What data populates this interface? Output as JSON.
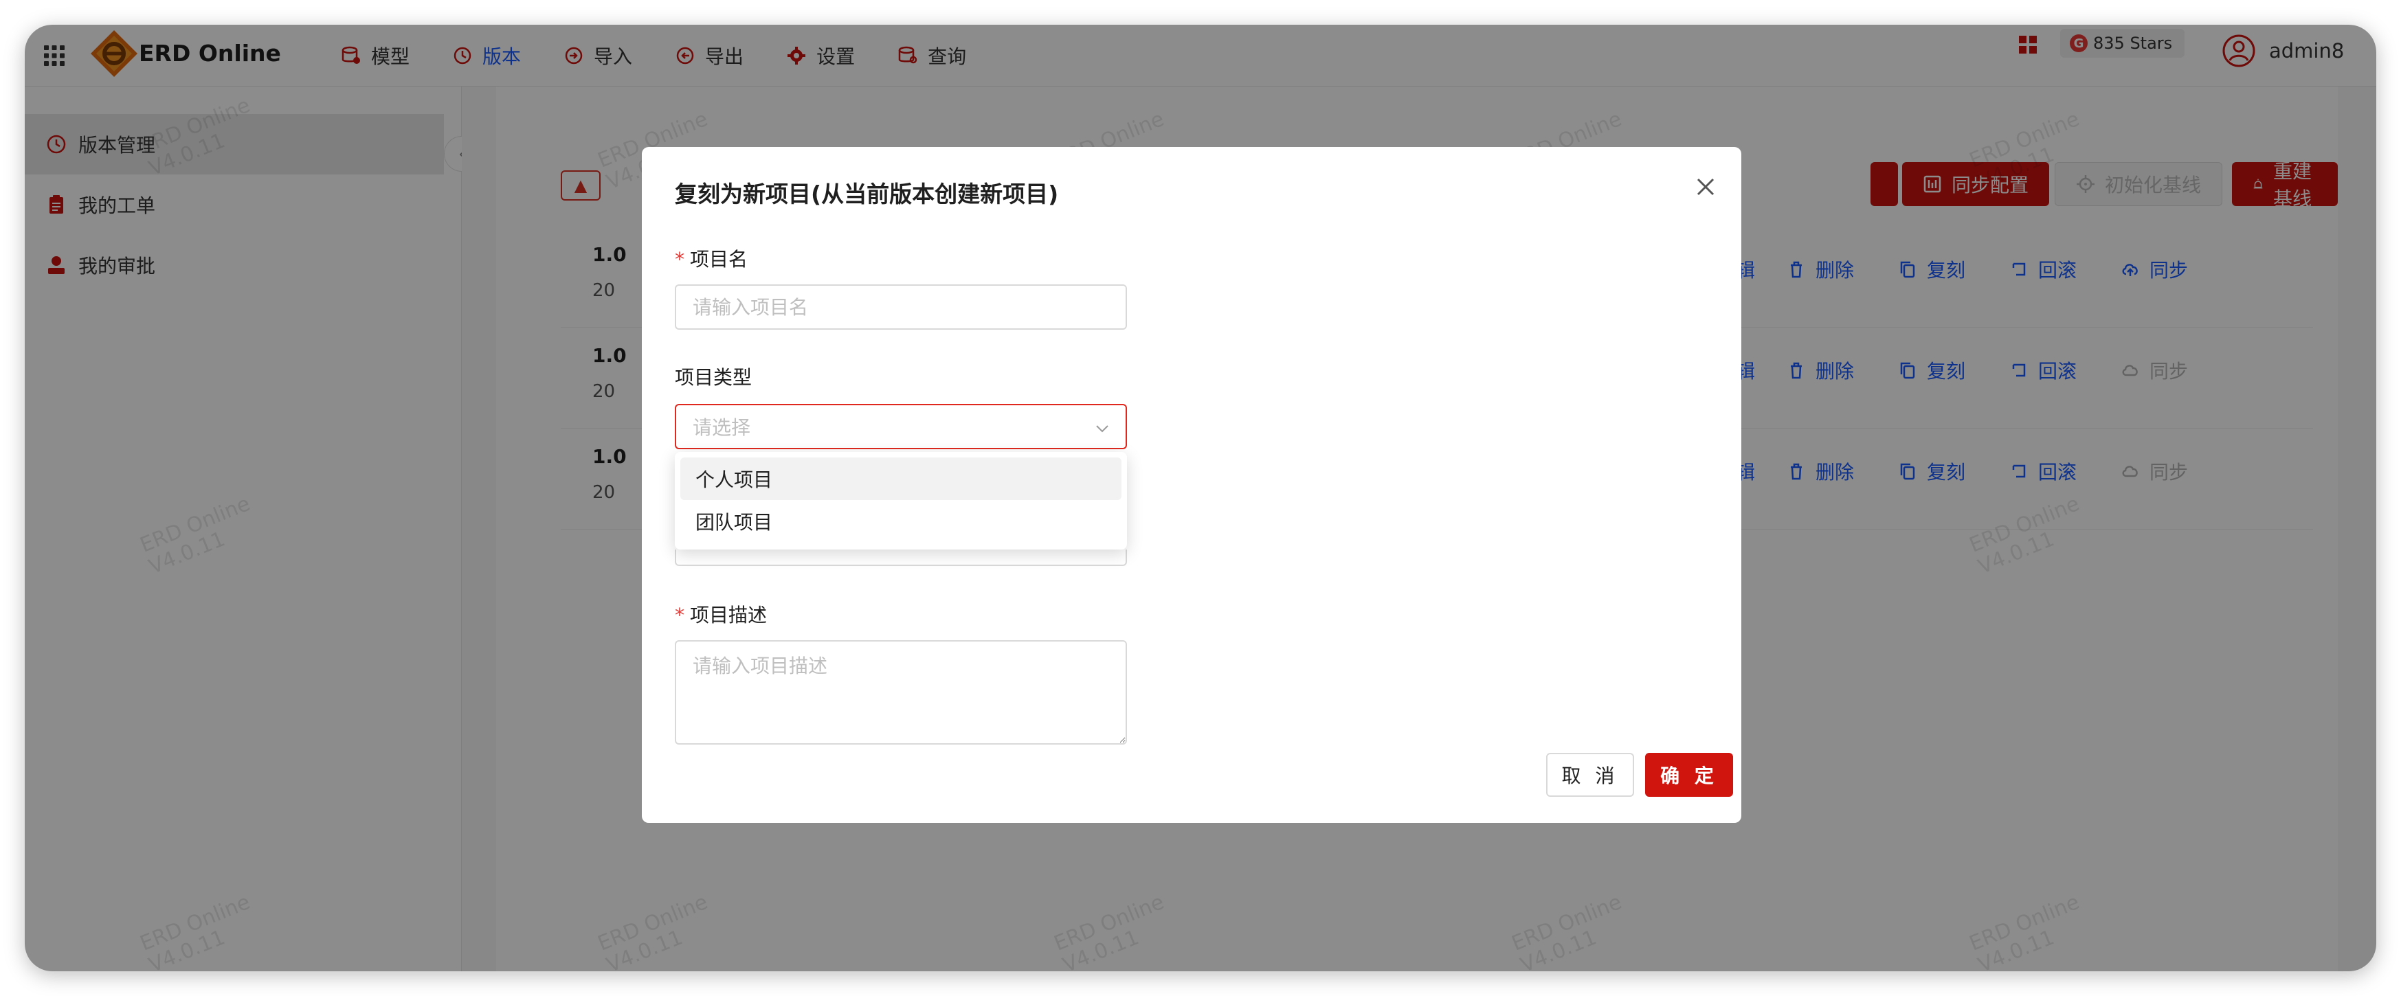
{
  "app": {
    "brand": "ERD Online",
    "stars": "835 Stars",
    "stars_badge": "G",
    "user": "admin8"
  },
  "nav": [
    {
      "label": "模型",
      "icon": "database-icon"
    },
    {
      "label": "版本",
      "icon": "history-icon",
      "active": true
    },
    {
      "label": "导入",
      "icon": "import-icon"
    },
    {
      "label": "导出",
      "icon": "export-icon"
    },
    {
      "label": "设置",
      "icon": "gear-icon"
    },
    {
      "label": "查询",
      "icon": "query-icon"
    }
  ],
  "sidebar": {
    "items": [
      {
        "label": "版本管理",
        "icon": "history-icon",
        "active": true
      },
      {
        "label": "我的工单",
        "icon": "clipboard-icon"
      },
      {
        "label": "我的审批",
        "icon": "user-check-icon"
      }
    ],
    "collapse": "‹"
  },
  "toolbar": {
    "warn": "▲",
    "sync_config": "同步配置",
    "init_baseline": "初始化基线",
    "rebuild_baseline": "重建基线"
  },
  "versions": [
    {
      "title": "1.0",
      "date": "20",
      "sync_enabled": true
    },
    {
      "title": "1.0",
      "date": "20",
      "sync_enabled": false
    },
    {
      "title": "1.0",
      "date": "20",
      "sync_enabled": false
    }
  ],
  "row_actions": {
    "edit": "辑",
    "delete": "删除",
    "copy": "复刻",
    "rollback": "回滚",
    "sync": "同步"
  },
  "watermark": "ERD Online\nV4.0.11",
  "modal": {
    "title": "复刻为新项目(从当前版本创建新项目)",
    "fields": {
      "name_label": "项目名",
      "name_placeholder": "请输入项目名",
      "type_label": "项目类型",
      "type_placeholder": "请选择",
      "type_options": [
        "个人项目",
        "团队项目"
      ],
      "desc_label": "项目描述",
      "desc_placeholder": "请输入项目描述"
    },
    "required_mark": "*",
    "cancel": "取 消",
    "ok": "确 定"
  },
  "colors": {
    "primary": "#c9140f",
    "link": "#1a5cff",
    "mask": "rgba(0,0,0,0.45)"
  }
}
